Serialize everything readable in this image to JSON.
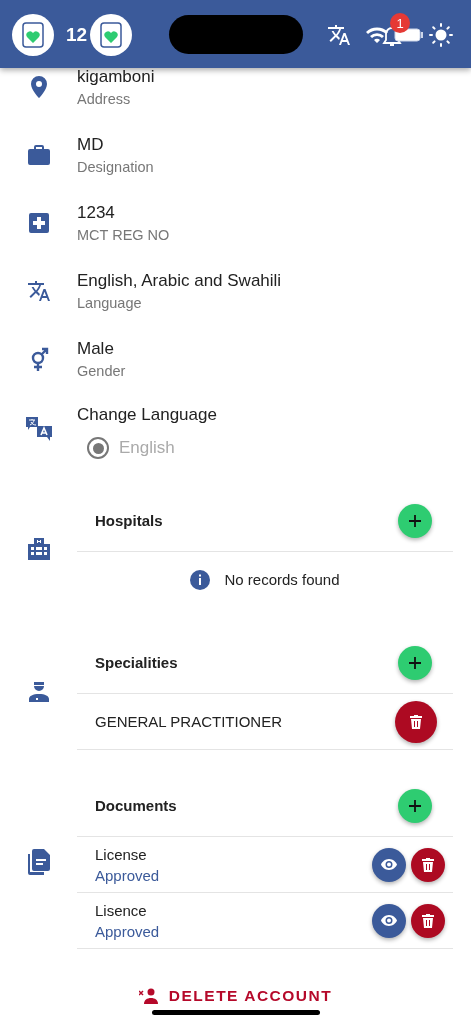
{
  "status_bar": {
    "time": "12",
    "notification_count": "1"
  },
  "profile_fields": [
    {
      "kind": "address",
      "value": "kigamboni",
      "label": "Address"
    },
    {
      "kind": "designation",
      "value": "MD",
      "label": "Designation"
    },
    {
      "kind": "registration",
      "value": "1234",
      "label": "MCT REG NO"
    },
    {
      "kind": "language",
      "value": "English, Arabic and Swahili",
      "label": "Language"
    },
    {
      "kind": "gender",
      "value": "Male",
      "label": "Gender"
    }
  ],
  "change_language": {
    "title": "Change Language",
    "options": [
      {
        "label": "English",
        "selected": true,
        "disabled": true
      }
    ]
  },
  "sections": [
    {
      "kind": "hospitals",
      "title": "Hospitals",
      "empty_message": "No records found"
    },
    {
      "kind": "specialities",
      "title": "Specialities",
      "items": [
        {
          "name": "GENERAL PRACTITIONER"
        }
      ]
    },
    {
      "kind": "documents",
      "title": "Documents",
      "items": [
        {
          "name": "License",
          "status": "Approved"
        },
        {
          "name": "Lisence",
          "status": "Approved"
        }
      ]
    }
  ],
  "delete_button": "DELETE ACCOUNT"
}
